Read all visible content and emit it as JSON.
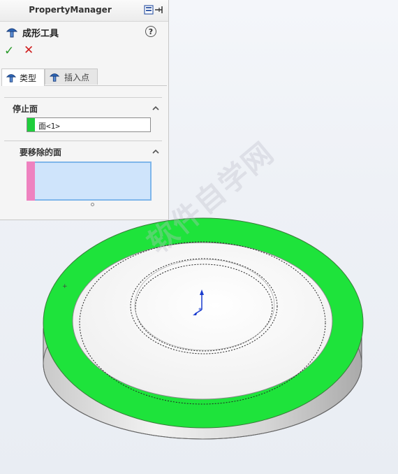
{
  "property_manager": {
    "title": "PropertyManager",
    "feature_name": "成形工具",
    "help_label": "?",
    "ok_label": "✓",
    "cancel_label": "✕",
    "tabs": [
      {
        "label": "类型",
        "active": true,
        "icon": "forming-tool-icon"
      },
      {
        "label": "插入点",
        "active": false,
        "icon": "forming-tool-icon"
      }
    ],
    "stop_face": {
      "title": "停止面",
      "value": "面<1>",
      "color": "#1fce3c"
    },
    "faces_to_remove": {
      "title": "要移除的面",
      "color": "#ee82c0",
      "items": []
    }
  },
  "model": {
    "ring_color": "#1ee33b",
    "face_color": "#ffffff",
    "side_color": "#d8d8d8"
  },
  "watermark_text": "软件自学网"
}
